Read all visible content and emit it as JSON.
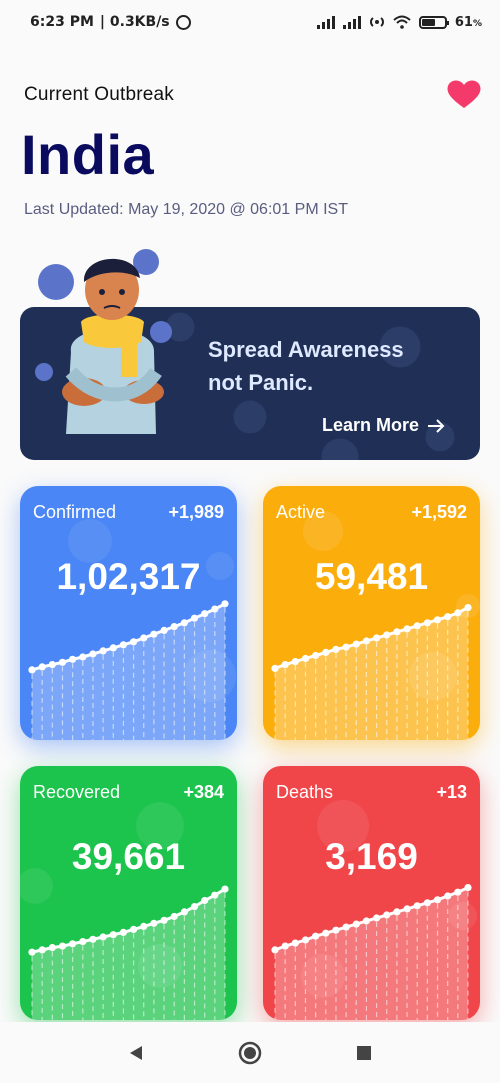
{
  "status_bar": {
    "time": "6:23 PM",
    "speed": "| 0.3KB/s",
    "battery": "61",
    "battery_unit": "%",
    "battery_level": 0.61
  },
  "header": {
    "subtitle": "Current Outbreak",
    "country": "India",
    "last_updated": "Last Updated: May 19, 2020 @ 06:01 PM IST",
    "favorite_icon": "heart-icon"
  },
  "banner": {
    "line1": "Spread Awareness",
    "line2": "not Panic.",
    "link_label": "Learn More"
  },
  "stats": {
    "confirmed": {
      "label": "Confirmed",
      "delta": "+1,989",
      "value": "1,02,317",
      "color": "#4a86f5",
      "trend": [
        0.08,
        0.12,
        0.15,
        0.18,
        0.22,
        0.25,
        0.29,
        0.33,
        0.37,
        0.41,
        0.45,
        0.5,
        0.55,
        0.6,
        0.65,
        0.7,
        0.76,
        0.82,
        0.88,
        0.95
      ]
    },
    "active": {
      "label": "Active",
      "delta": "+1,592",
      "value": "59,481",
      "color": "#fbad0c",
      "trend": [
        0.1,
        0.15,
        0.19,
        0.23,
        0.27,
        0.31,
        0.35,
        0.38,
        0.42,
        0.46,
        0.5,
        0.54,
        0.58,
        0.62,
        0.66,
        0.7,
        0.74,
        0.78,
        0.83,
        0.9
      ]
    },
    "recovered": {
      "label": "Recovered",
      "delta": "+384",
      "value": "39,661",
      "color": "#1cc34c",
      "trend": [
        0.05,
        0.08,
        0.11,
        0.13,
        0.16,
        0.19,
        0.22,
        0.25,
        0.28,
        0.31,
        0.35,
        0.39,
        0.43,
        0.47,
        0.52,
        0.58,
        0.65,
        0.73,
        0.8,
        0.88
      ]
    },
    "deaths": {
      "label": "Deaths",
      "delta": "+13",
      "value": "3,169",
      "color": "#f0464a",
      "trend": [
        0.08,
        0.13,
        0.17,
        0.21,
        0.26,
        0.3,
        0.34,
        0.38,
        0.42,
        0.46,
        0.5,
        0.54,
        0.58,
        0.62,
        0.66,
        0.7,
        0.74,
        0.79,
        0.84,
        0.9
      ]
    }
  },
  "nav": {
    "back_icon": "back-triangle-icon",
    "home_icon": "home-circle-icon",
    "recents_icon": "recents-square-icon"
  }
}
